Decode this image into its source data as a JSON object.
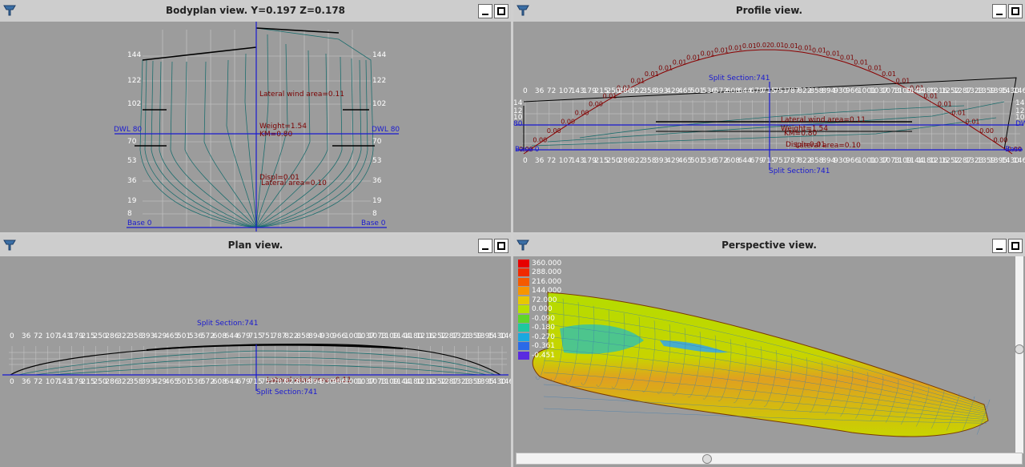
{
  "panes": {
    "bodyplan": {
      "title": "Bodyplan view.  Y=0.197  Z=0.178",
      "waterlines": [
        "144",
        "122",
        "102",
        "80",
        "70",
        "53",
        "36",
        "19",
        "8"
      ],
      "dwl_left": "DWL 80",
      "dwl_right": "DWL 80",
      "base_left": "Base 0",
      "base_right": "Base 0",
      "annotations": {
        "lateral_wind_area": "Lateral wind area=0.11",
        "weight": "Weight=1.54",
        "km": "KM=0.80",
        "displ": "Displ=0.01",
        "lateral_area": "Lateral area=0.10"
      }
    },
    "profile": {
      "title": "Profile view.",
      "split_label_top": "Split Section:741",
      "split_label_bottom": "Split Section:741",
      "annotations": {
        "lateral_wind_area": "Lateral wind area=0.11",
        "weight": "Weight=1.54",
        "km": "KM=0.80",
        "displ": "Displ=0.01",
        "lateral_area": "Lateral area=0.10"
      },
      "left_waterlines": [
        "14",
        "12",
        "10",
        "80"
      ],
      "right_waterlines": [
        "14",
        "12",
        "10",
        "DWL"
      ],
      "base_left": "Base 0",
      "base_right": "Base",
      "curve_labels": [
        "0.00",
        "0.00",
        "0.00",
        "0.00",
        "0.00",
        "0.00",
        "0.01",
        "0.01",
        "0.01",
        "0.01",
        "0.01",
        "0.01",
        "0.01",
        "0.01",
        "0.01",
        "0.01",
        "0.01",
        "0.02",
        "0.01",
        "0.01",
        "0.01",
        "0.01",
        "0.01",
        "0.01",
        "0.01",
        "0.01",
        "0.01",
        "0.01",
        "0.01",
        "0.01",
        "0.01",
        "0.01",
        "0.01",
        "0.00",
        "0.00",
        "0.00"
      ]
    },
    "plan": {
      "title": "Plan view.",
      "split_label_top": "Split Section:741",
      "split_label_bottom": "Split Section:741",
      "overlap_text": "Lateral wind area=0.11"
    },
    "perspective": {
      "title": "Perspective view.",
      "legend": [
        {
          "value": "360.000",
          "color": "#e60000"
        },
        {
          "value": "288.000",
          "color": "#f02a00"
        },
        {
          "value": "216.000",
          "color": "#f55a00"
        },
        {
          "value": "144.000",
          "color": "#f79500"
        },
        {
          "value": "72.000",
          "color": "#e8c800"
        },
        {
          "value": "0.000",
          "color": "#b8e000"
        },
        {
          "value": "-0.090",
          "color": "#5fd628"
        },
        {
          "value": "-0.180",
          "color": "#1ec8a0"
        },
        {
          "value": "-0.270",
          "color": "#1aa8e0"
        },
        {
          "value": "-0.361",
          "color": "#2a6ae8"
        },
        {
          "value": "-0.451",
          "color": "#5a2ae0"
        }
      ]
    }
  },
  "station_labels": [
    "0",
    "36",
    "72",
    "107",
    "143",
    "179",
    "215",
    "250",
    "286",
    "322",
    "358",
    "393",
    "429",
    "465",
    "501",
    "536",
    "572",
    "608",
    "644",
    "679",
    "715",
    "751",
    "787",
    "822",
    "858",
    "894",
    "930",
    "966",
    "1001",
    "1037",
    "1073",
    "1109",
    "1144",
    "1180",
    "1216",
    "1252",
    "1287",
    "1323",
    "1359",
    "1395",
    "1430",
    "1466"
  ],
  "colors": {
    "pane_bg": "#9c9c9c",
    "hull_lines": "#1e6e6e",
    "curves": "#8b0000",
    "split_line": "#1a1ad0"
  }
}
